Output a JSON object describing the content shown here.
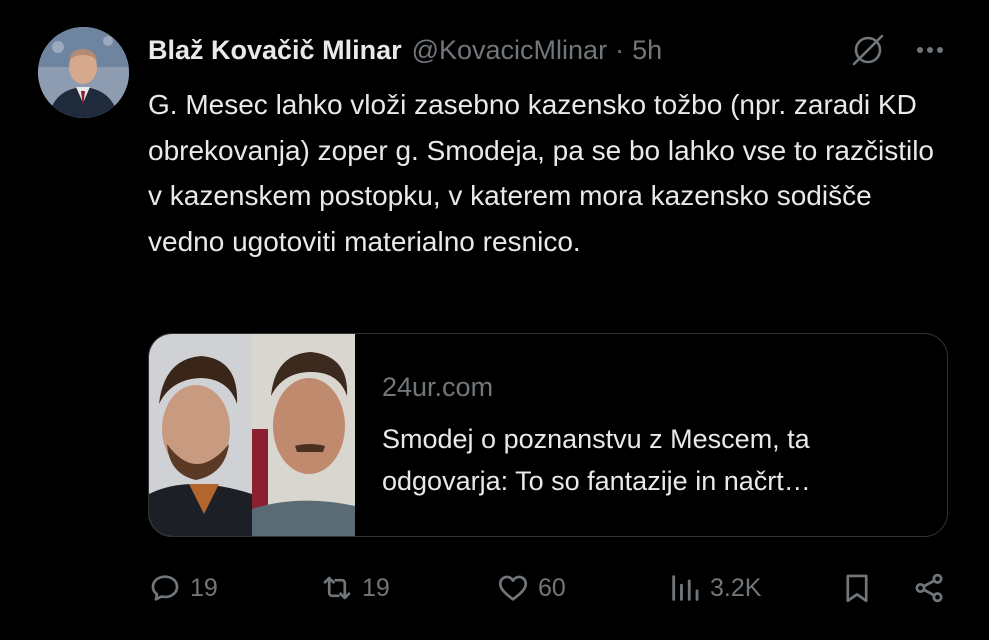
{
  "author": {
    "name": "Blaž Kovačič Mlinar",
    "handle": "@KovacicMlinar",
    "separator": "·",
    "time": "5h"
  },
  "tweet": {
    "text": "G. Mesec lahko vloži zasebno kazensko tožbo (npr. zaradi KD obrekovanja) zoper g. Smodeja, pa se bo lahko vse to razčistilo v kazenskem postopku, v katerem mora kazensko sodišče vedno ugotoviti materialno resnico."
  },
  "card": {
    "domain": "24ur.com",
    "title": "Smodej o poznanstvu z Mescem, ta odgovarja: To so fantazije in načrt…"
  },
  "actions": {
    "replies": "19",
    "reposts": "19",
    "likes": "60",
    "views": "3.2K"
  },
  "icons": {
    "reply": "reply-icon",
    "repost": "repost-icon",
    "like": "heart-icon",
    "views": "views-icon",
    "bookmark": "bookmark-icon",
    "share": "share-icon",
    "grok": "grok-icon",
    "more": "more-icon"
  },
  "colors": {
    "background": "#000000",
    "text": "#e7e9ea",
    "secondary": "#71767b",
    "border": "#2f3336"
  }
}
